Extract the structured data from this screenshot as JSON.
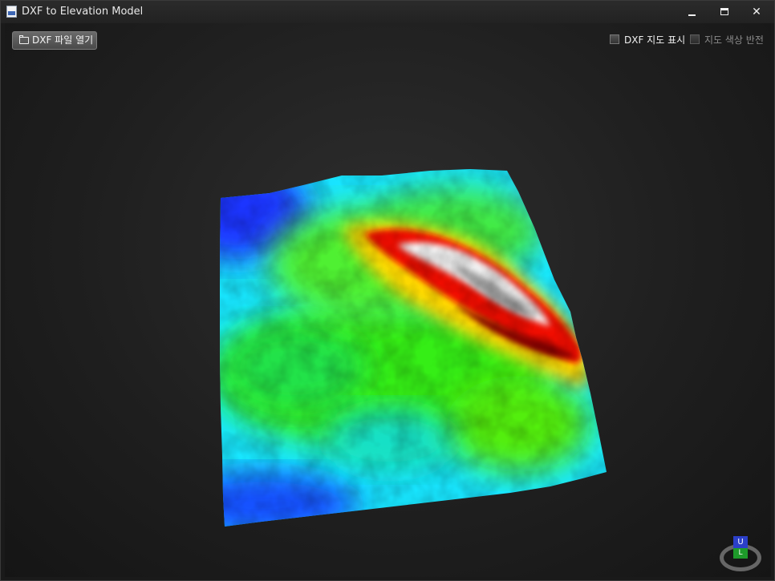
{
  "window": {
    "title": "DXF to Elevation Model",
    "minimize_label": "",
    "close_label": "✕"
  },
  "toolbar": {
    "open_dxf_label": "DXF 파일 열기"
  },
  "options": {
    "show_dxf_map_label": "DXF 지도 표시",
    "show_dxf_map_checked": false,
    "invert_map_color_label": "지도 색상 반전",
    "invert_map_color_checked": false,
    "invert_map_color_enabled": false
  },
  "nav_cube": {
    "top_face": "U",
    "front_face": "L"
  },
  "colors": {
    "elevation_low": "#1a2bff",
    "elevation_mid_low": "#00e5ff",
    "elevation_mid": "#22ee00",
    "elevation_mid_high": "#ffd400",
    "elevation_high": "#e60000",
    "elevation_peak": "#ffffff",
    "background": "#1f1f1f"
  }
}
